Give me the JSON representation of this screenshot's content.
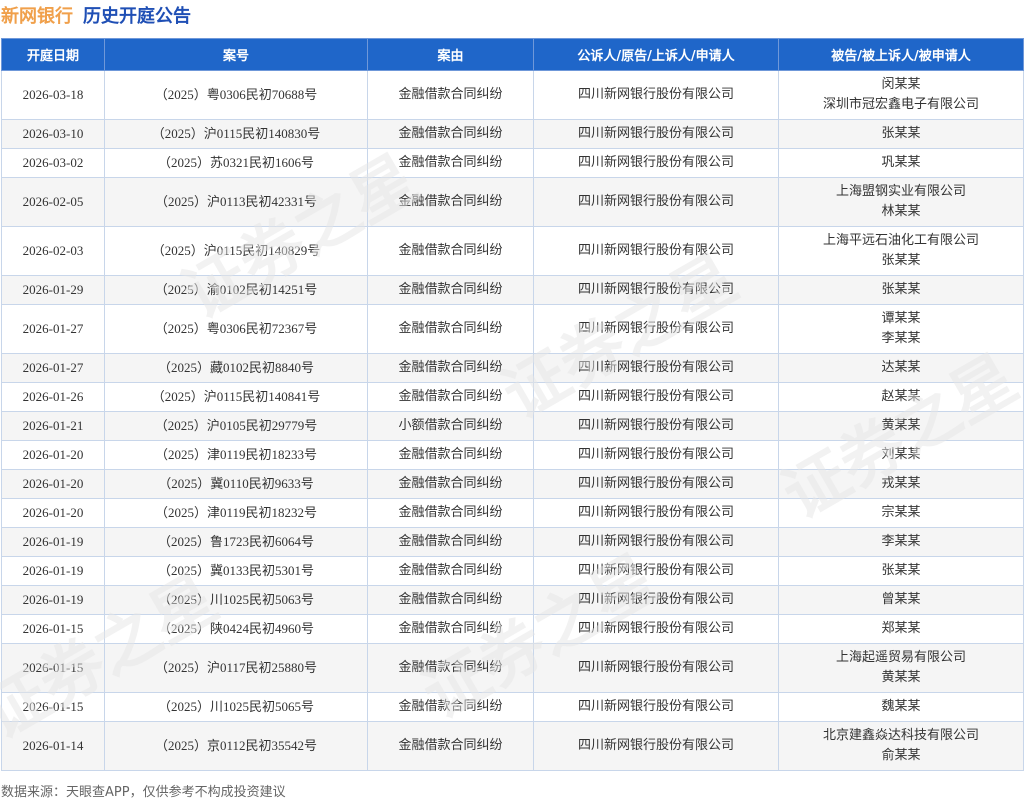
{
  "header": {
    "company": "新网银行",
    "section": "历史开庭公告"
  },
  "columns": {
    "date": "开庭日期",
    "case_no": "案号",
    "reason": "案由",
    "plaintiff": "公诉人/原告/上诉人/申请人",
    "defendant": "被告/被上诉人/被申请人"
  },
  "rows": [
    {
      "date": "2026-03-18",
      "case_no": "（2025）粤0306民初70688号",
      "reason": "金融借款合同纠纷",
      "plaintiff": "四川新网银行股份有限公司",
      "defendants": [
        "闵某某",
        "深圳市冠宏鑫电子有限公司"
      ]
    },
    {
      "date": "2026-03-10",
      "case_no": "（2025）沪0115民初140830号",
      "reason": "金融借款合同纠纷",
      "plaintiff": "四川新网银行股份有限公司",
      "defendants": [
        "张某某"
      ]
    },
    {
      "date": "2026-03-02",
      "case_no": "（2025）苏0321民初1606号",
      "reason": "金融借款合同纠纷",
      "plaintiff": "四川新网银行股份有限公司",
      "defendants": [
        "巩某某"
      ]
    },
    {
      "date": "2026-02-05",
      "case_no": "（2025）沪0113民初42331号",
      "reason": "金融借款合同纠纷",
      "plaintiff": "四川新网银行股份有限公司",
      "defendants": [
        "上海盟钢实业有限公司",
        "林某某"
      ]
    },
    {
      "date": "2026-02-03",
      "case_no": "（2025）沪0115民初140829号",
      "reason": "金融借款合同纠纷",
      "plaintiff": "四川新网银行股份有限公司",
      "defendants": [
        "上海平远石油化工有限公司",
        "张某某"
      ]
    },
    {
      "date": "2026-01-29",
      "case_no": "（2025）渝0102民初14251号",
      "reason": "金融借款合同纠纷",
      "plaintiff": "四川新网银行股份有限公司",
      "defendants": [
        "张某某"
      ]
    },
    {
      "date": "2026-01-27",
      "case_no": "（2025）粤0306民初72367号",
      "reason": "金融借款合同纠纷",
      "plaintiff": "四川新网银行股份有限公司",
      "defendants": [
        "谭某某",
        "李某某"
      ]
    },
    {
      "date": "2026-01-27",
      "case_no": "（2025）藏0102民初8840号",
      "reason": "金融借款合同纠纷",
      "plaintiff": "四川新网银行股份有限公司",
      "defendants": [
        "达某某"
      ]
    },
    {
      "date": "2026-01-26",
      "case_no": "（2025）沪0115民初140841号",
      "reason": "金融借款合同纠纷",
      "plaintiff": "四川新网银行股份有限公司",
      "defendants": [
        "赵某某"
      ]
    },
    {
      "date": "2026-01-21",
      "case_no": "（2025）沪0105民初29779号",
      "reason": "小额借款合同纠纷",
      "plaintiff": "四川新网银行股份有限公司",
      "defendants": [
        "黄某某"
      ]
    },
    {
      "date": "2026-01-20",
      "case_no": "（2025）津0119民初18233号",
      "reason": "金融借款合同纠纷",
      "plaintiff": "四川新网银行股份有限公司",
      "defendants": [
        "刘某某"
      ]
    },
    {
      "date": "2026-01-20",
      "case_no": "（2025）冀0110民初9633号",
      "reason": "金融借款合同纠纷",
      "plaintiff": "四川新网银行股份有限公司",
      "defendants": [
        "戎某某"
      ]
    },
    {
      "date": "2026-01-20",
      "case_no": "（2025）津0119民初18232号",
      "reason": "金融借款合同纠纷",
      "plaintiff": "四川新网银行股份有限公司",
      "defendants": [
        "宗某某"
      ]
    },
    {
      "date": "2026-01-19",
      "case_no": "（2025）鲁1723民初6064号",
      "reason": "金融借款合同纠纷",
      "plaintiff": "四川新网银行股份有限公司",
      "defendants": [
        "李某某"
      ]
    },
    {
      "date": "2026-01-19",
      "case_no": "（2025）冀0133民初5301号",
      "reason": "金融借款合同纠纷",
      "plaintiff": "四川新网银行股份有限公司",
      "defendants": [
        "张某某"
      ]
    },
    {
      "date": "2026-01-19",
      "case_no": "（2025）川1025民初5063号",
      "reason": "金融借款合同纠纷",
      "plaintiff": "四川新网银行股份有限公司",
      "defendants": [
        "曾某某"
      ]
    },
    {
      "date": "2026-01-15",
      "case_no": "（2025）陕0424民初4960号",
      "reason": "金融借款合同纠纷",
      "plaintiff": "四川新网银行股份有限公司",
      "defendants": [
        "郑某某"
      ]
    },
    {
      "date": "2026-01-15",
      "case_no": "（2025）沪0117民初25880号",
      "reason": "金融借款合同纠纷",
      "plaintiff": "四川新网银行股份有限公司",
      "defendants": [
        "上海起遥贸易有限公司",
        "黄某某"
      ]
    },
    {
      "date": "2026-01-15",
      "case_no": "（2025）川1025民初5065号",
      "reason": "金融借款合同纠纷",
      "plaintiff": "四川新网银行股份有限公司",
      "defendants": [
        "魏某某"
      ]
    },
    {
      "date": "2026-01-14",
      "case_no": "（2025）京0112民初35542号",
      "reason": "金融借款合同纠纷",
      "plaintiff": "四川新网银行股份有限公司",
      "defendants": [
        "北京建鑫焱达科技有限公司",
        "俞某某"
      ]
    }
  ],
  "footer": {
    "source": "数据来源：天眼查APP，仅供参考不构成投资建议"
  },
  "watermark": {
    "text": "证券之星"
  },
  "colors": {
    "header_bg": "#1f66c9",
    "company": "#f0a04b",
    "section": "#1f4fb5",
    "row_alt": "#f5f5f5"
  }
}
